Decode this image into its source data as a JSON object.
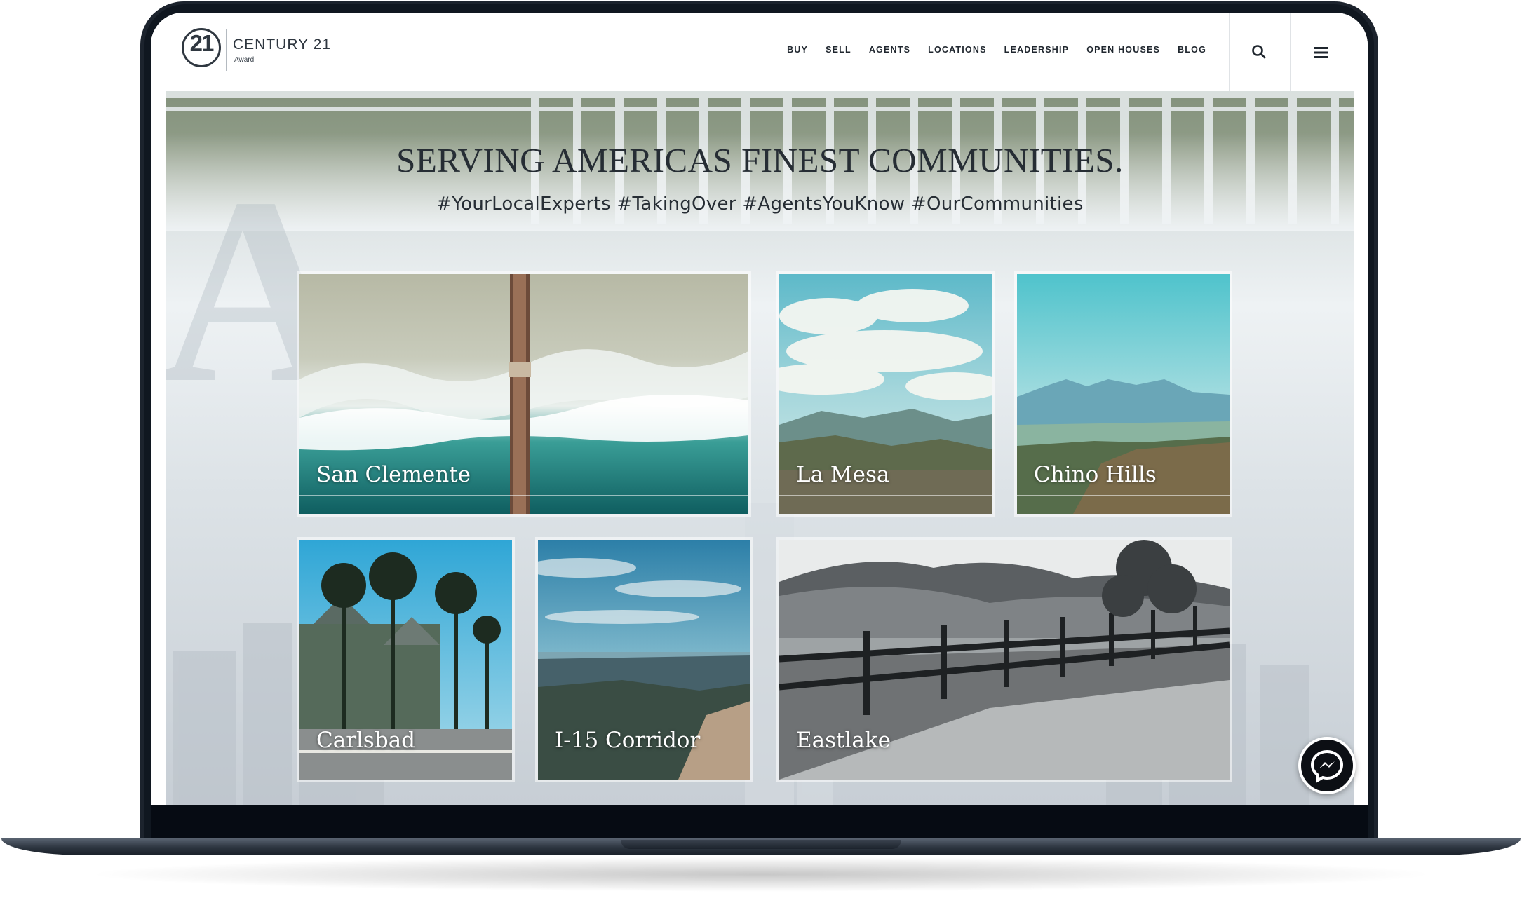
{
  "brand": {
    "seal_number": "21",
    "name": "CENTURY 21",
    "sub": "Award"
  },
  "nav": {
    "items": [
      "BUY",
      "SELL",
      "AGENTS",
      "LOCATIONS",
      "LEADERSHIP",
      "OPEN HOUSES",
      "BLOG"
    ]
  },
  "header_icons": {
    "search": "search-icon",
    "menu": "hamburger-menu-icon"
  },
  "hero": {
    "title": "SERVING AMERICAS FINEST COMMUNITIES.",
    "hashtags": "#YourLocalExperts #TakingOver #AgentsYouKnow #OurCommunities"
  },
  "communities": [
    {
      "name": "San Clemente",
      "image": "aerial pier over ocean waves"
    },
    {
      "name": "La Mesa",
      "image": "valley under cloudy sky"
    },
    {
      "name": "Chino Hills",
      "image": "mountains over town"
    },
    {
      "name": "Carlsbad",
      "image": "palm trees and victorian building"
    },
    {
      "name": "I-15 Corridor",
      "image": "hills and ocean horizon"
    },
    {
      "name": "Eastlake",
      "image": "black and white ranch fence and hills"
    }
  ],
  "chat": {
    "icon": "messenger-icon"
  },
  "colors": {
    "frame": "#1c232d",
    "text": "#262d34",
    "accent_ocean": "#2f8f88",
    "sky": "#5fc6cf"
  }
}
